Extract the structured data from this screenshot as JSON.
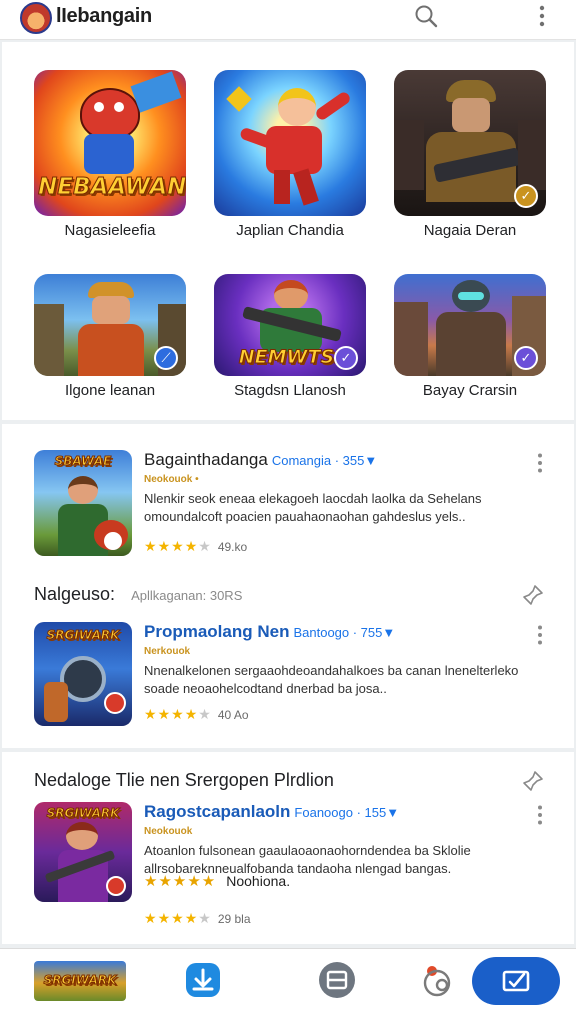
{
  "app": {
    "title": "lIebangain"
  },
  "icons": {
    "search": "search-icon",
    "more": "more-vertical-icon",
    "pin": "pin-icon",
    "nav": [
      "game-thumbnail",
      "download-icon",
      "library-icon",
      "friends-icon",
      "inbox-icon"
    ]
  },
  "colors": {
    "accent": "#1a5fc9",
    "star": "#f4b400",
    "title_blue": "#1a5bb8",
    "meta_blue": "#1a73e8"
  },
  "featured": [
    {
      "label": "Nagasieleefia",
      "art_text": "NEBAAWAN",
      "badge": ""
    },
    {
      "label": "Japlian Chandia",
      "art_text": "",
      "badge": ""
    },
    {
      "label": "Nagaia Deran",
      "art_text": "",
      "badge": "✓"
    },
    {
      "label": "Ilgone leanan",
      "art_text": "",
      "badge": "⟋"
    },
    {
      "label": "Stagdsn Llanosh",
      "art_text": "NEMWTSI",
      "badge": "✓"
    },
    {
      "label": "Bayay Crarsin",
      "art_text": "",
      "badge": "✓"
    }
  ],
  "list": [
    {
      "title": "Bagainthadanga",
      "meta": "Comangia · 355▼",
      "subtitle": "Neokouok •",
      "description": "Nlenkir seok eneaa elekagoeh laocdah laolka da Sehelans omoundalcoft poacien pauahaonaohan gahdeslus yels..",
      "stars": "★★★★★",
      "rating": 4,
      "count": "49.ko",
      "art_text": "SBAWAE"
    },
    {
      "title": "Propmaolang Nen",
      "meta": "Bantoogo · 755▼",
      "subtitle": "Nerkouok",
      "description": "Nnenalkelonen sergaaohdeoandahalkoes ba canan lnenelterleko soade neoaohelcodtand dnerbad ba josa..",
      "stars": "★★★★★",
      "rating": 4,
      "count": "40 Ao",
      "art_text": "SRGIWARK"
    }
  ],
  "section_one": {
    "heading": "Nalgeuso:",
    "sub": "Apllkaganan: 30RS"
  },
  "section_two": {
    "heading": "Nedaloge Tlie nen Srergopen Plrdlion"
  },
  "list2": [
    {
      "title": "Ragostcapanlaoln",
      "meta": "Foanoogo · 155▼",
      "subtitle": "Neokouok",
      "description": "Atoanlon fulsonean gaaulaoaonaohorndendea ba Sklolie allrsobareknneualfobanda tandaoha nlengad bangas.",
      "extra_stars": "★★★★★",
      "extra_text": "Noohiona.",
      "stars": "★★★★★",
      "rating": 4,
      "count": "29 bla",
      "art_text": "SRGIWARK"
    }
  ],
  "bottom_nav": {
    "game_art_text": "SRGIWARK"
  }
}
